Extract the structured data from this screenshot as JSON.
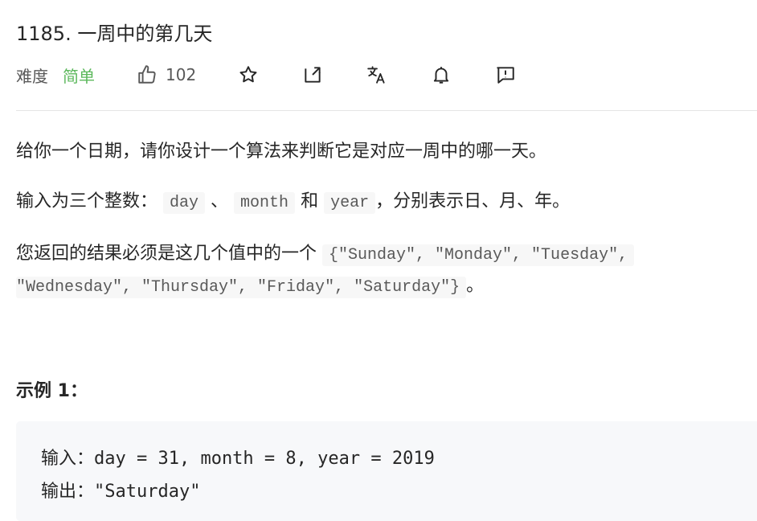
{
  "problem": {
    "title": "1185. 一周中的第几天",
    "difficulty_label": "难度",
    "difficulty_value": "简单",
    "likes": "102"
  },
  "icons": [
    "thumbs-up-icon",
    "star-icon",
    "share-icon",
    "translate-icon",
    "bell-icon",
    "feedback-icon"
  ],
  "colors": {
    "difficulty_easy": "#5cb85c",
    "code_bg": "#f7f8fa",
    "divider": "#e5e5e5"
  },
  "description": {
    "p1": "给你一个日期，请你设计一个算法来判断它是对应一周中的哪一天。",
    "p2_prefix": "输入为三个整数：",
    "code_day": "day",
    "sep1": "、",
    "code_month": "month",
    "sep2": "和",
    "code_year": "year",
    "p2_suffix": "，分别表示日、月、年。",
    "p3_prefix": "您返回的结果必须是这几个值中的一个",
    "values_line1": "{\"Sunday\", \"Monday\", \"Tuesday\",",
    "values_line2": "\"Wednesday\", \"Thursday\", \"Friday\", \"Saturday\"}",
    "p3_suffix": "。"
  },
  "example": {
    "title": "示例 1：",
    "input_line": "输入：day = 31, month = 8, year = 2019",
    "output_line": "输出：\"Saturday\""
  }
}
